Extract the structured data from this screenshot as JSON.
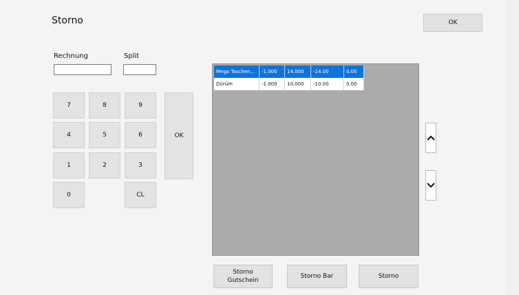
{
  "title": "Storno",
  "ok_top_label": "OK",
  "inputs": {
    "rechnung_label": "Rechnung",
    "rechnung_value": "",
    "split_label": "Split",
    "split_value": ""
  },
  "keypad": {
    "keys": [
      "7",
      "8",
      "9",
      "4",
      "5",
      "6",
      "1",
      "2",
      "3",
      "0",
      "CL"
    ],
    "ok_label": "OK"
  },
  "table": {
    "rows": [
      {
        "name": "Mega Taschen...",
        "qty": "-1.000",
        "price": "14.000",
        "total": "-14.00",
        "extra": "0.00",
        "selected": true
      },
      {
        "name": "Dürüm",
        "qty": "-1.000",
        "price": "10.000",
        "total": "-10.00",
        "extra": "0.00",
        "selected": false
      }
    ]
  },
  "buttons": {
    "storno_gutschein": "Storno\nGutschein",
    "storno_bar": "Storno Bar",
    "storno": "Storno"
  },
  "icons": {
    "scroll_up": "chevron-up-icon",
    "scroll_down": "chevron-down-icon"
  }
}
